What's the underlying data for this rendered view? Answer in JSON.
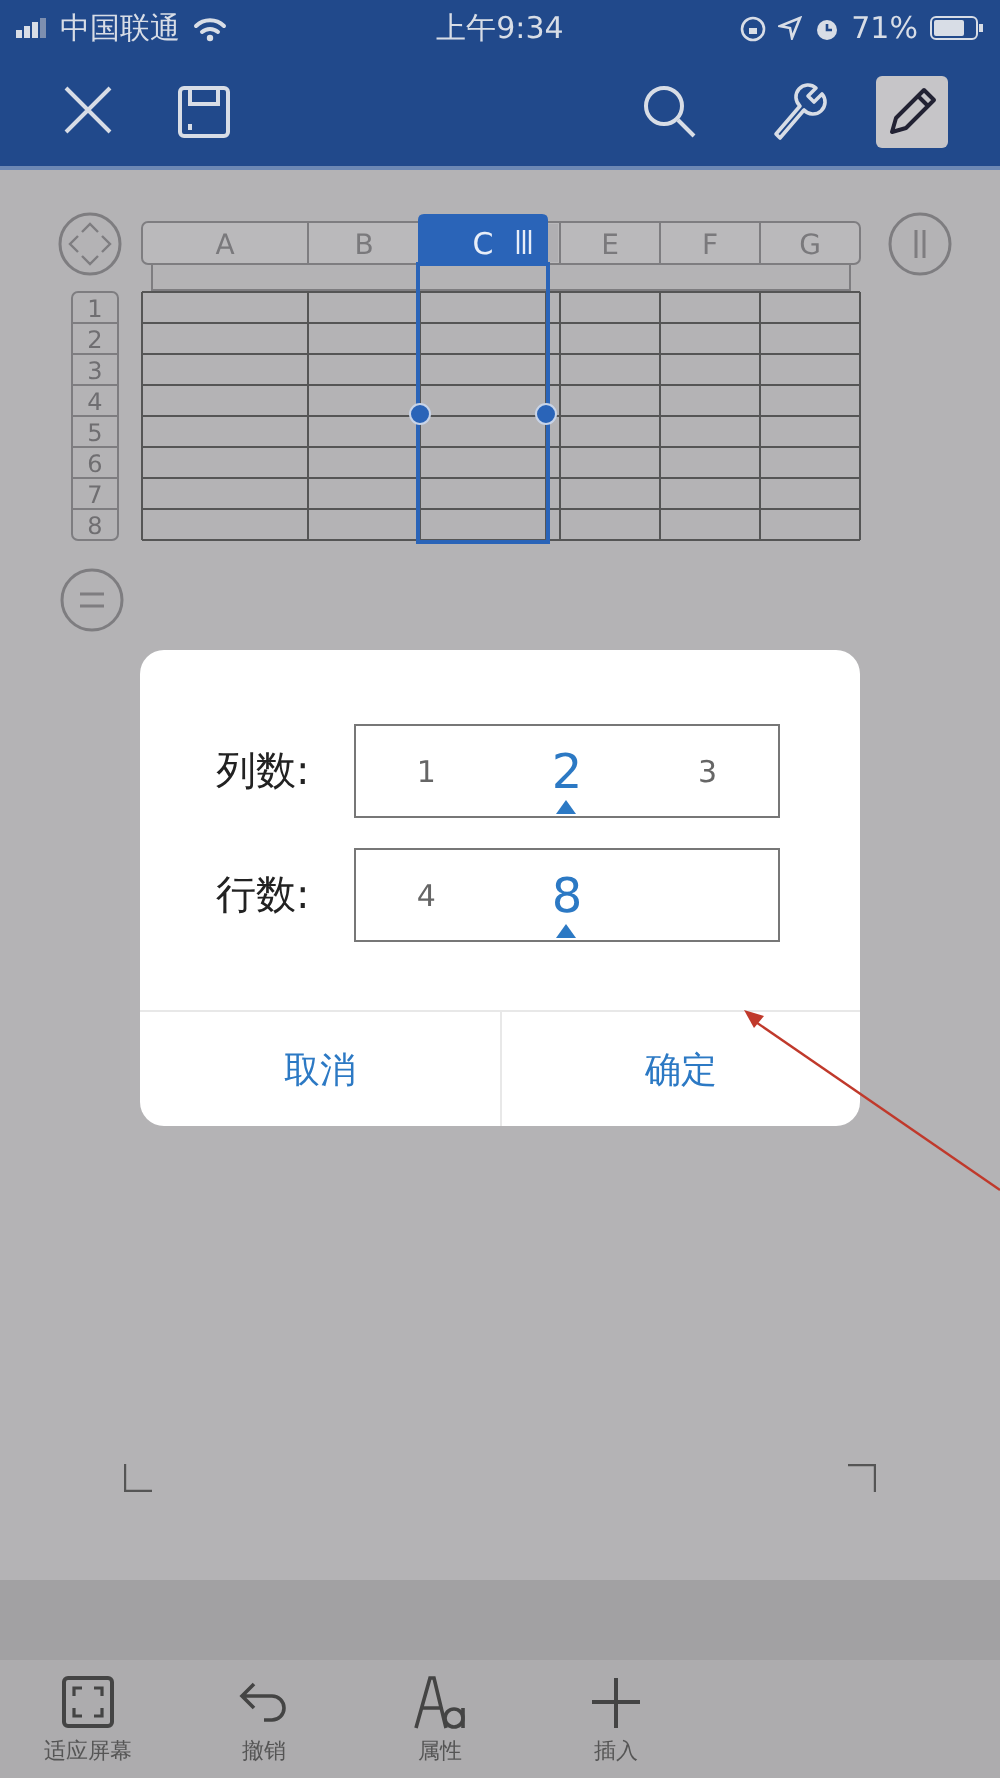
{
  "status_bar": {
    "carrier": "中国联通",
    "time": "上午9:34",
    "battery": "71%"
  },
  "toolbar": [
    {
      "kind": "close",
      "selected": false
    },
    {
      "kind": "save",
      "selected": false
    },
    {
      "kind": "search",
      "selected": false
    },
    {
      "kind": "wrench",
      "selected": false
    },
    {
      "kind": "pencil",
      "selected": true
    }
  ],
  "sheet": {
    "columns": [
      {
        "label": "A",
        "selected": false
      },
      {
        "label": "B",
        "selected": false
      },
      {
        "label": "C",
        "selected": true
      },
      {
        "selected": false
      },
      {
        "label": "E",
        "selected": false
      },
      {
        "label": "F",
        "selected": false
      },
      {
        "label": "G",
        "selected": false
      }
    ],
    "rows": [
      "1",
      "2",
      "3",
      "4",
      "5",
      "6",
      "7",
      "8"
    ]
  },
  "dialog": {
    "fields": [
      {
        "label": "列数:",
        "options": [
          {
            "value": "1",
            "selected": false
          },
          {
            "value": "2",
            "selected": true
          },
          {
            "value": "3",
            "selected": false
          }
        ]
      },
      {
        "label": "行数:",
        "options": [
          {
            "value": "4",
            "selected": false
          },
          {
            "value": "8",
            "selected": true
          }
        ]
      }
    ],
    "buttons": [
      "取消",
      "确定"
    ]
  },
  "bottom_toolbar": [
    {
      "kind": "fit",
      "label": "适应屏幕"
    },
    {
      "kind": "undo",
      "label": "撤销"
    },
    {
      "kind": "format",
      "label": "属性"
    },
    {
      "kind": "insert",
      "label": "插入"
    }
  ]
}
